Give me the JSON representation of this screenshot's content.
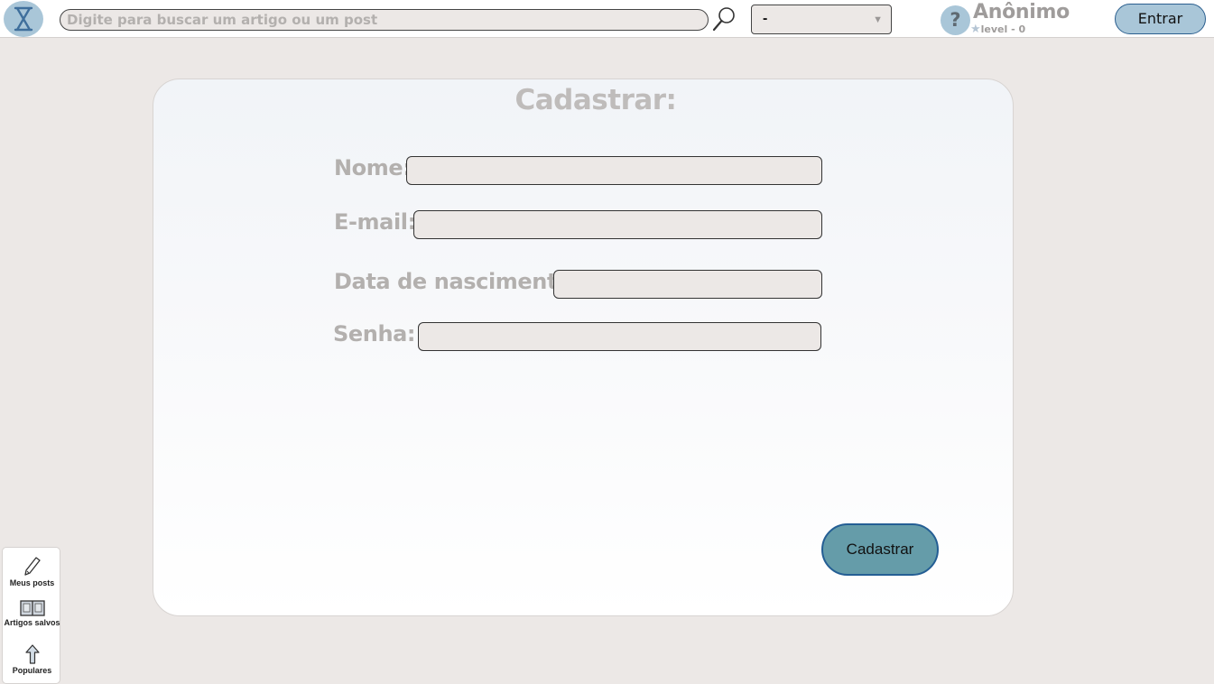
{
  "header": {
    "search_placeholder": "Digite para buscar um artigo ou um post",
    "filter_value": "-",
    "user_name": "Anônimo",
    "user_level": "level - 0",
    "login_label": "Entrar"
  },
  "form": {
    "title": "Cadastrar:",
    "fields": [
      {
        "label": "Nome:"
      },
      {
        "label": "E-mail:"
      },
      {
        "label": "Data de nascimento:"
      },
      {
        "label": "Senha:"
      }
    ],
    "submit_label": "Cadastrar"
  },
  "sidenav": {
    "items": [
      {
        "label": "Meus posts",
        "icon": "pencil-icon"
      },
      {
        "label": "Artigos salvos",
        "icon": "book-icon"
      },
      {
        "label": "Populares",
        "icon": "arrow-up-icon"
      }
    ]
  },
  "colors": {
    "accent": "#a9c6d8",
    "submit": "#659ca9",
    "background": "#ece8e6"
  }
}
